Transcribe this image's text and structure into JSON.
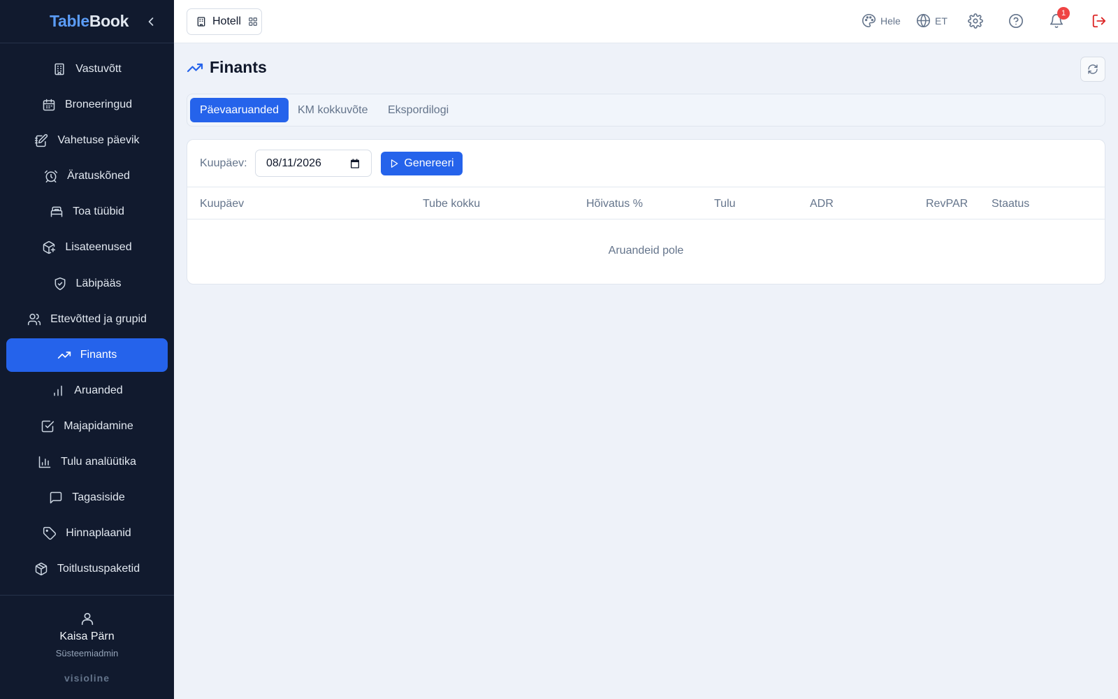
{
  "app": {
    "brand_part1": "Table",
    "brand_part2": "Book",
    "footer_brand": "visioline",
    "accent_color": "#2563eb",
    "sidebar_bg": "#111a2e"
  },
  "sidebar": {
    "items": [
      {
        "label": "Vastuvõtt",
        "icon": "building-icon"
      },
      {
        "label": "Broneeringud",
        "icon": "calendar-icon"
      },
      {
        "label": "Vahetuse päevik",
        "icon": "edit-note-icon"
      },
      {
        "label": "Äratuskõned",
        "icon": "alarm-clock-icon"
      },
      {
        "label": "Toa tüübid",
        "icon": "bed-icon"
      },
      {
        "label": "Lisateenused",
        "icon": "package-plus-icon"
      },
      {
        "label": "Läbipääs",
        "icon": "shield-check-icon"
      },
      {
        "label": "Ettevõtted ja grupid",
        "icon": "users-icon"
      },
      {
        "label": "Finants",
        "icon": "trending-up-icon",
        "active": true
      },
      {
        "label": "Aruanded",
        "icon": "bar-chart-icon"
      },
      {
        "label": "Majapidamine",
        "icon": "checkbox-icon"
      },
      {
        "label": "Tulu analüütika",
        "icon": "column-chart-icon"
      },
      {
        "label": "Tagasiside",
        "icon": "message-icon"
      },
      {
        "label": "Hinnaplaanid",
        "icon": "tag-icon"
      },
      {
        "label": "Toitlustuspaketid",
        "icon": "box-icon"
      }
    ],
    "user": {
      "name": "Kaisa Pärn",
      "role": "Süsteemiadmin"
    }
  },
  "topbar": {
    "hotel_label": "Hotell",
    "theme_label": "Hele",
    "language_label": "ET",
    "notification_count": "1"
  },
  "page": {
    "title": "Finants",
    "tabs": [
      {
        "label": "Päevaaruanded",
        "active": true
      },
      {
        "label": "KM kokkuvõte",
        "active": false
      },
      {
        "label": "Ekspordilogi",
        "active": false
      }
    ],
    "filter": {
      "date_label": "Kuupäev:",
      "date_value": "08/11/2026",
      "generate_label": "Genereeri"
    },
    "table": {
      "columns": [
        "Kuupäev",
        "Tube kokku",
        "Hõivatus %",
        "Tulu",
        "ADR",
        "RevPAR",
        "Staatus"
      ],
      "rows": [],
      "empty_text": "Aruandeid pole"
    }
  }
}
